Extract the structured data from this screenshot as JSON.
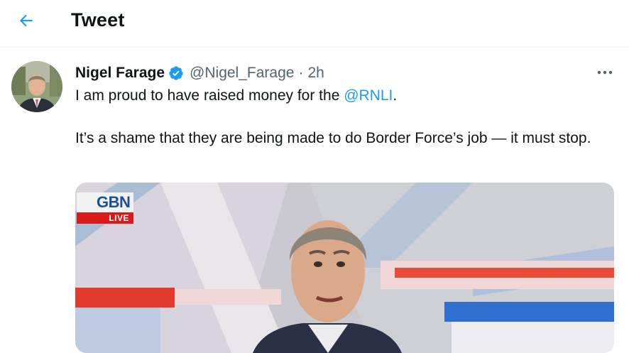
{
  "header": {
    "title": "Tweet",
    "back_icon": "arrow-left-icon"
  },
  "tweet": {
    "author_name": "Nigel Farage",
    "handle": "@Nigel_Farage",
    "separator": "·",
    "time": "2h",
    "verified_icon": "verified-badge-icon",
    "more_icon": "more-horizontal-icon",
    "text_line1_prefix": "I am proud to have raised money for the ",
    "mention": "@RNLI",
    "text_line1_suffix": ".",
    "text_para2": "It’s a shame that they are being made to do Border Force’s job — it must stop."
  },
  "media": {
    "logo_text": "GBN",
    "live_label": "LIVE"
  },
  "colors": {
    "accent": "#1d9bf0",
    "text": "#0f1419",
    "muted": "#536471",
    "live_red": "#d91a1a",
    "logo_blue": "#1a4fa0"
  }
}
